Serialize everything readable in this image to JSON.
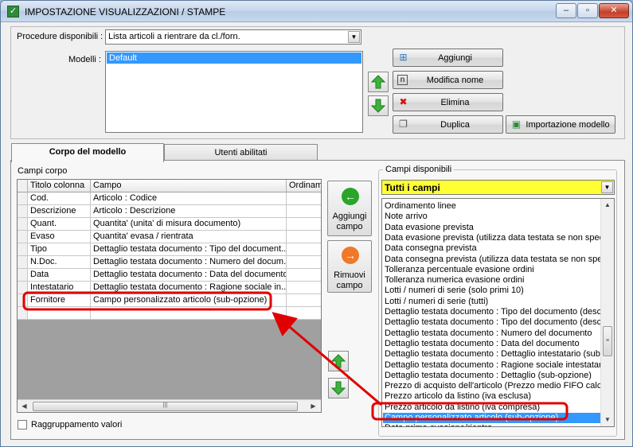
{
  "window": {
    "title": "IMPOSTAZIONE VISUALIZZAZIONI / STAMPE",
    "controls": [
      "–",
      "▫",
      "✕"
    ]
  },
  "top": {
    "procedure_label": "Procedure disponibili :",
    "procedure_value": "Lista articoli a rientrare da cl./forn.",
    "models_label": "Modelli :",
    "models": [
      "Default"
    ],
    "buttons": {
      "add": "Aggiungi",
      "rename": "Modifica nome",
      "delete": "Elimina",
      "duplicate": "Duplica",
      "import": "Importazione modello"
    }
  },
  "tabs": [
    "Corpo del modello",
    "Utenti abilitati"
  ],
  "body": {
    "fields_label": "Campi corpo",
    "columns": [
      "Titolo colonna",
      "Campo",
      "Ordinamento"
    ],
    "rows": [
      {
        "title": "Cod.",
        "field": "Articolo : Codice"
      },
      {
        "title": "Descrizione",
        "field": "Articolo : Descrizione"
      },
      {
        "title": "Quant.",
        "field": "Quantita' (unita' di misura documento)"
      },
      {
        "title": "Evaso",
        "field": "Quantita' evasa / rientrata"
      },
      {
        "title": "Tipo",
        "field": "Dettaglio testata documento : Tipo del document..."
      },
      {
        "title": "N.Doc.",
        "field": "Dettaglio testata documento : Numero del docum..."
      },
      {
        "title": "Data",
        "field": "Dettaglio testata documento : Data del documento"
      },
      {
        "title": "Intestatario",
        "field": "Dettaglio testata documento : Ragione sociale in..."
      },
      {
        "title": "Fornitore",
        "field": "Campo personalizzato articolo (sub-opzione)"
      },
      {
        "title": "",
        "field": ""
      }
    ],
    "add_field": [
      "Aggiungi",
      "campo"
    ],
    "remove_field": [
      "Rimuovi",
      "campo"
    ],
    "grouping_label": "Raggruppamento valori"
  },
  "available": {
    "group_label": "Campi disponibili",
    "filter_value": "Tutti i campi",
    "items": [
      "Ordinamento linee",
      "Note arrivo",
      "Data evasione prevista",
      "Data evasione prevista (utilizza data testata se non specif",
      "Data consegna prevista",
      "Data consegna prevista (utilizza data testata se non speci",
      "Tolleranza percentuale evasione ordini",
      "Tolleranza numerica evasione ordini",
      "Lotti / numeri di serie (solo primi 10)",
      "Lotti / numeri di serie (tutti)",
      "Dettaglio testata documento : Tipo del documento (descri",
      "Dettaglio testata documento : Tipo del documento (descri",
      "Dettaglio testata documento : Numero del documento",
      "Dettaglio testata documento : Data del documento",
      "Dettaglio testata documento : Dettaglio intestatario (sub-o",
      "Dettaglio testata documento : Ragione sociale intestatario",
      "Dettaglio testata documento : Dettaglio (sub-opzione)",
      "Prezzo di acquisto dell'articolo (Prezzo medio FIFO calcola",
      "Prezzo articolo da listino (iva esclusa)",
      "Prezzo articolo da listino (iva compresa)",
      "Campo personalizzato articolo (sub-opzione)",
      "Data prima evasione/rientro"
    ],
    "selected_index": 20
  },
  "colors": {
    "selection": "#3399ff",
    "filter_bg": "#ffff33",
    "annotation": "#e00000"
  }
}
